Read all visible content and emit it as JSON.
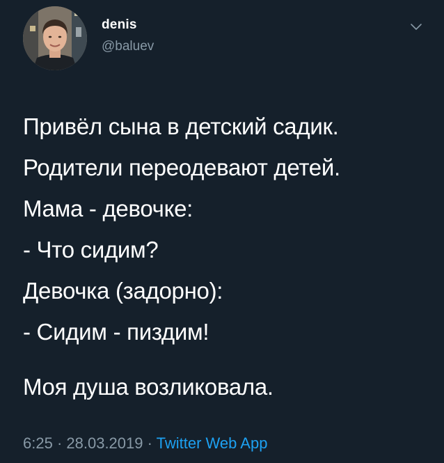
{
  "author": {
    "display_name": "denis",
    "handle": "@baluev"
  },
  "icons": {
    "avatar": "profile-photo",
    "menu": "chevron-down-icon"
  },
  "tweet": {
    "lines": [
      "Привёл сына в детский садик.",
      "Родители переодевают детей.",
      "Мама - девочке:",
      "- Что сидим?",
      "Девочка (задорно):",
      "- Сидим - пиздим!"
    ],
    "closing_line": "Моя душа возликовала."
  },
  "meta": {
    "time": "6:25",
    "separator": " · ",
    "date": "28.03.2019",
    "source": "Twitter Web App"
  },
  "colors": {
    "background": "#15202b",
    "text": "#ffffff",
    "secondary_text": "#8899a6",
    "link": "#1da1f2"
  }
}
